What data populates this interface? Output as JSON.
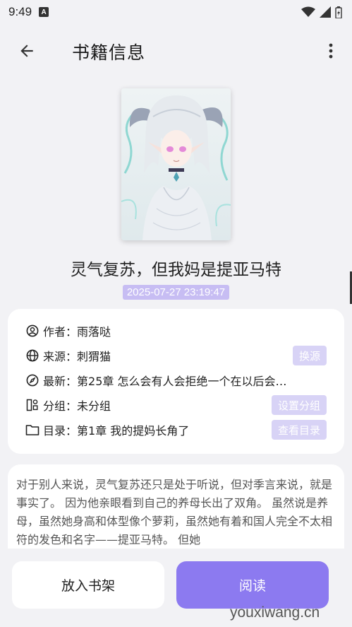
{
  "status_bar": {
    "time": "9:49",
    "notification_glyph": "A"
  },
  "app_bar": {
    "title": "书籍信息",
    "back_icon": "arrow-left-icon",
    "more_icon": "more-vertical-icon"
  },
  "book": {
    "title": "灵气复苏，但我妈是提亚马特",
    "updated_at": "2025-07-27 23:19:47"
  },
  "info": {
    "author": {
      "label": "作者：",
      "value": "雨落哒",
      "icon": "person-circle-icon"
    },
    "source": {
      "label": "来源：",
      "value": "刺猬猫",
      "action": "换源",
      "icon": "globe-icon"
    },
    "latest": {
      "label": "最新：",
      "value": "第25章 怎么会有人会拒绝一个在以后会…",
      "icon": "compass-icon"
    },
    "group": {
      "label": "分组：",
      "value": "未分组",
      "action": "设置分组",
      "icon": "group-icon"
    },
    "toc": {
      "label": "目录：",
      "value": "第1章 我的提妈长角了",
      "action": "查看目录",
      "icon": "folder-icon"
    }
  },
  "description": "对于别人来说，灵气复苏还只是处于听说，但对季言来说，就是事实了。 因为他亲眼看到自己的养母长出了双角。 虽然说是养母，虽然她身高和体型像个萝莉，虽然她有着和国人完全不太相符的发色和名字——提亚马特。 但她",
  "actions": {
    "add_to_shelf": "放入书架",
    "read": "阅读"
  },
  "watermark": "youxiwang.cn",
  "colors": {
    "accent": "#8c7af0",
    "tag_bg": "#d8d3f6",
    "timestamp_bg": "#c7bdf3",
    "background": "#f2f2f5"
  }
}
